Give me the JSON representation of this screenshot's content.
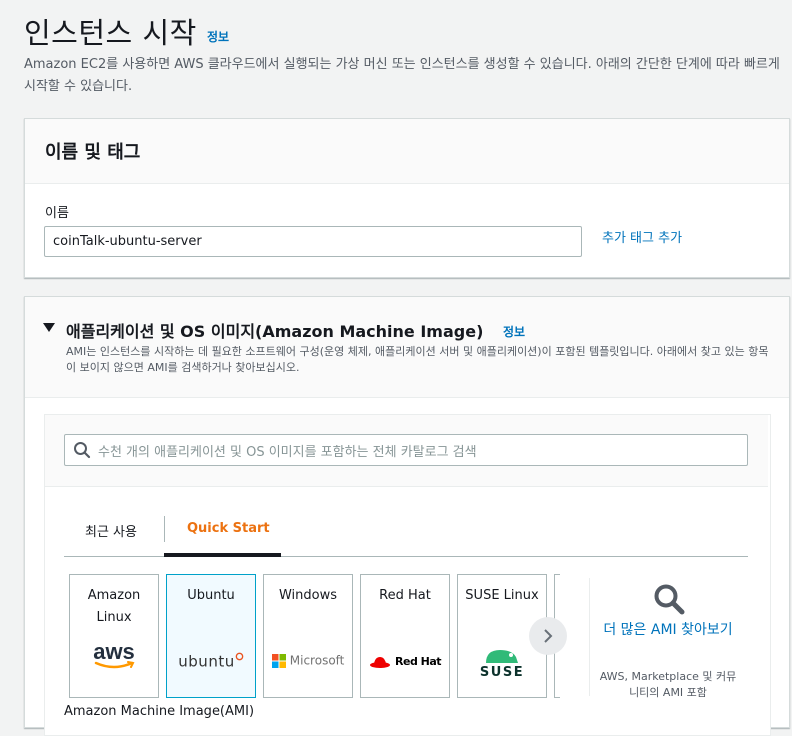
{
  "page": {
    "title": "인스턴스 시작",
    "title_info": "정보",
    "description": "Amazon EC2를 사용하면 AWS 클라우드에서 실행되는 가상 머신 또는 인스턴스를 생성할 수 있습니다. 아래의 간단한 단계에 따라 빠르게 시작할 수 있습니다."
  },
  "name_tags": {
    "header": "이름 및 태그",
    "name_label": "이름",
    "name_value": "coinTalk-ubuntu-server",
    "add_tags": "추가 태그 추가"
  },
  "ami_section": {
    "title": "애플리케이션 및 OS 이미지(Amazon Machine Image)",
    "info": "정보",
    "description": "AMI는 인스턴스를 시작하는 데 필요한 소프트웨어 구성(운영 체제, 애플리케이션 서버 및 애플리케이션)이 포함된 템플릿입니다. 아래에서 찾고 있는 항목이 보이지 않으면 AMI를 검색하거나 찾아보십시오.",
    "search_placeholder": "수천 개의 애플리케이션 및 OS 이미지를 포함하는 전체 카탈로그 검색",
    "tabs": [
      {
        "label": "최근 사용",
        "active": false
      },
      {
        "label": "Quick Start",
        "active": true
      }
    ],
    "cards": [
      {
        "name": "Amazon Linux",
        "logo": "aws-logo",
        "logo_text": "aws",
        "selected": false
      },
      {
        "name": "Ubuntu",
        "logo": "ubuntu-logo",
        "logo_text": "ubuntu",
        "selected": true
      },
      {
        "name": "Windows",
        "logo": "microsoft-logo",
        "logo_text": "Microsoft",
        "selected": false
      },
      {
        "name": "Red Hat",
        "logo": "redhat-logo",
        "logo_text": "Red Hat",
        "selected": false
      },
      {
        "name": "SUSE Linux",
        "logo": "suse-logo",
        "logo_text": "SUSE",
        "selected": false
      }
    ],
    "more": {
      "label": "더 많은 AMI 찾아보기",
      "sub": "AWS, Marketplace 및 커뮤니티의 AMI 포함"
    },
    "ami_footer_label": "Amazon Machine Image(AMI)"
  },
  "colors": {
    "link": "#0073bb",
    "accent_orange": "#ec7211",
    "selected_border": "#00a1c9",
    "selected_bg": "#f1faff"
  }
}
